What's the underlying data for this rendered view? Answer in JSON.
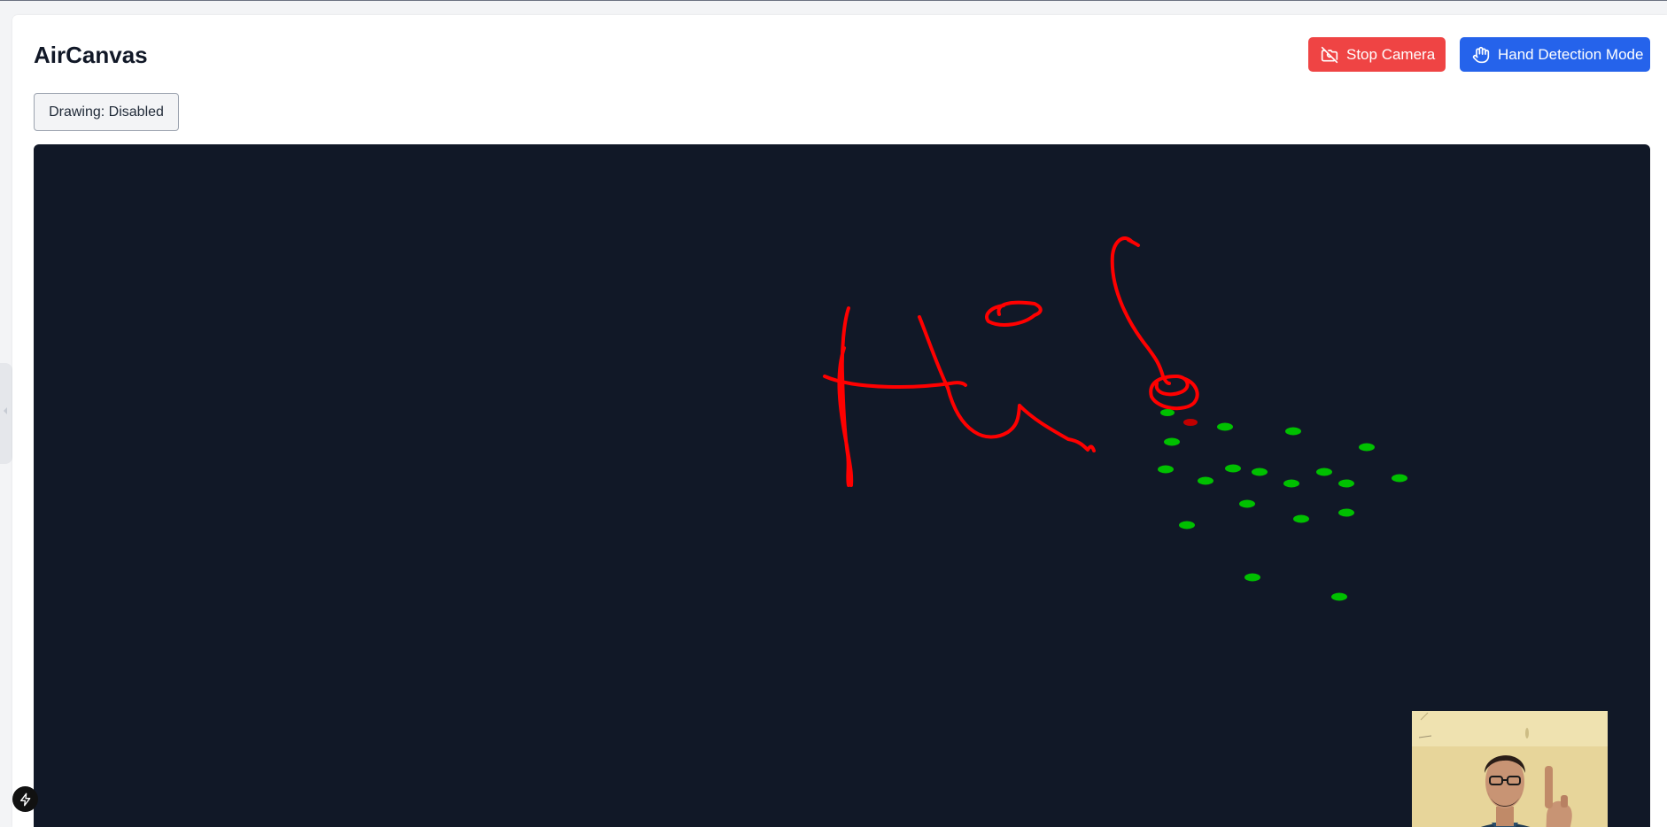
{
  "app": {
    "title": "AirCanvas"
  },
  "header": {
    "stop_camera": {
      "label": "Stop Camera",
      "icon": "camera-off-icon",
      "color": "#ef4444"
    },
    "hand_detection": {
      "label": "Hand Detection Mode",
      "icon": "hand-icon",
      "color": "#2563eb"
    }
  },
  "drawing_toggle": {
    "label": "Drawing: Disabled"
  },
  "canvas": {
    "background": "#111827",
    "stroke_color": "#ff0000",
    "landmark_color": "#00c000",
    "active_point_color": "#c00000"
  },
  "webcam_preview": {
    "icon": "webcam-preview"
  },
  "corner_badge": {
    "icon": "lightning-icon"
  }
}
